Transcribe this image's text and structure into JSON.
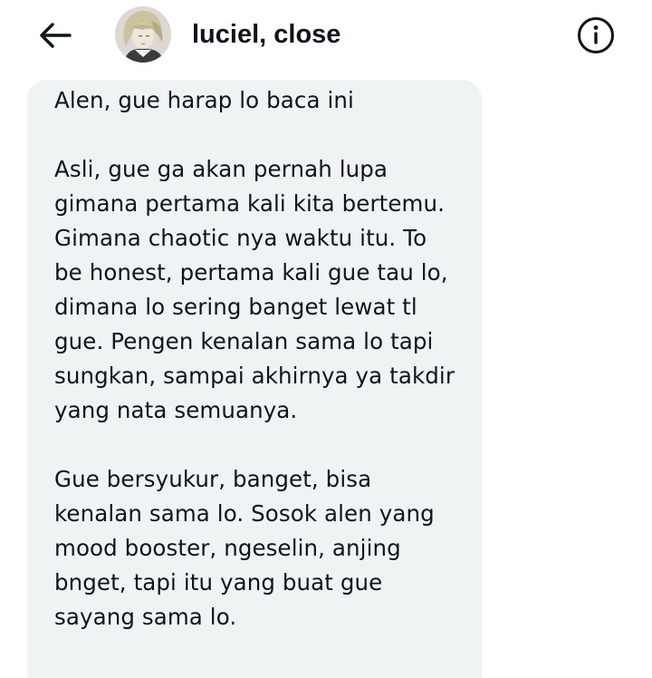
{
  "header": {
    "back_icon": "arrow-left-icon",
    "title": "luciel, close",
    "info_icon": "info-circle-icon"
  },
  "message": {
    "text": "Alen, gue harap lo baca ini\n\nAsli, gue ga akan pernah lupa\ngimana pertama kali kita bertemu.\nGimana chaotic nya waktu itu. To\nbe honest, pertama kali gue tau lo,\ndimana lo sering banget lewat tl\ngue. Pengen kenalan sama lo tapi\nsungkan, sampai akhirnya ya takdir\nyang nata semuanya.\n\nGue bersyukur, banget, bisa\nkenalan sama lo. Sosok alen yang\nmood booster, ngeselin, anjing\nbnget, tapi itu yang buat gue\nsayang sama lo."
  },
  "colors": {
    "bubble_background": "#eff3f4",
    "text": "#0f1419",
    "background": "#ffffff"
  }
}
